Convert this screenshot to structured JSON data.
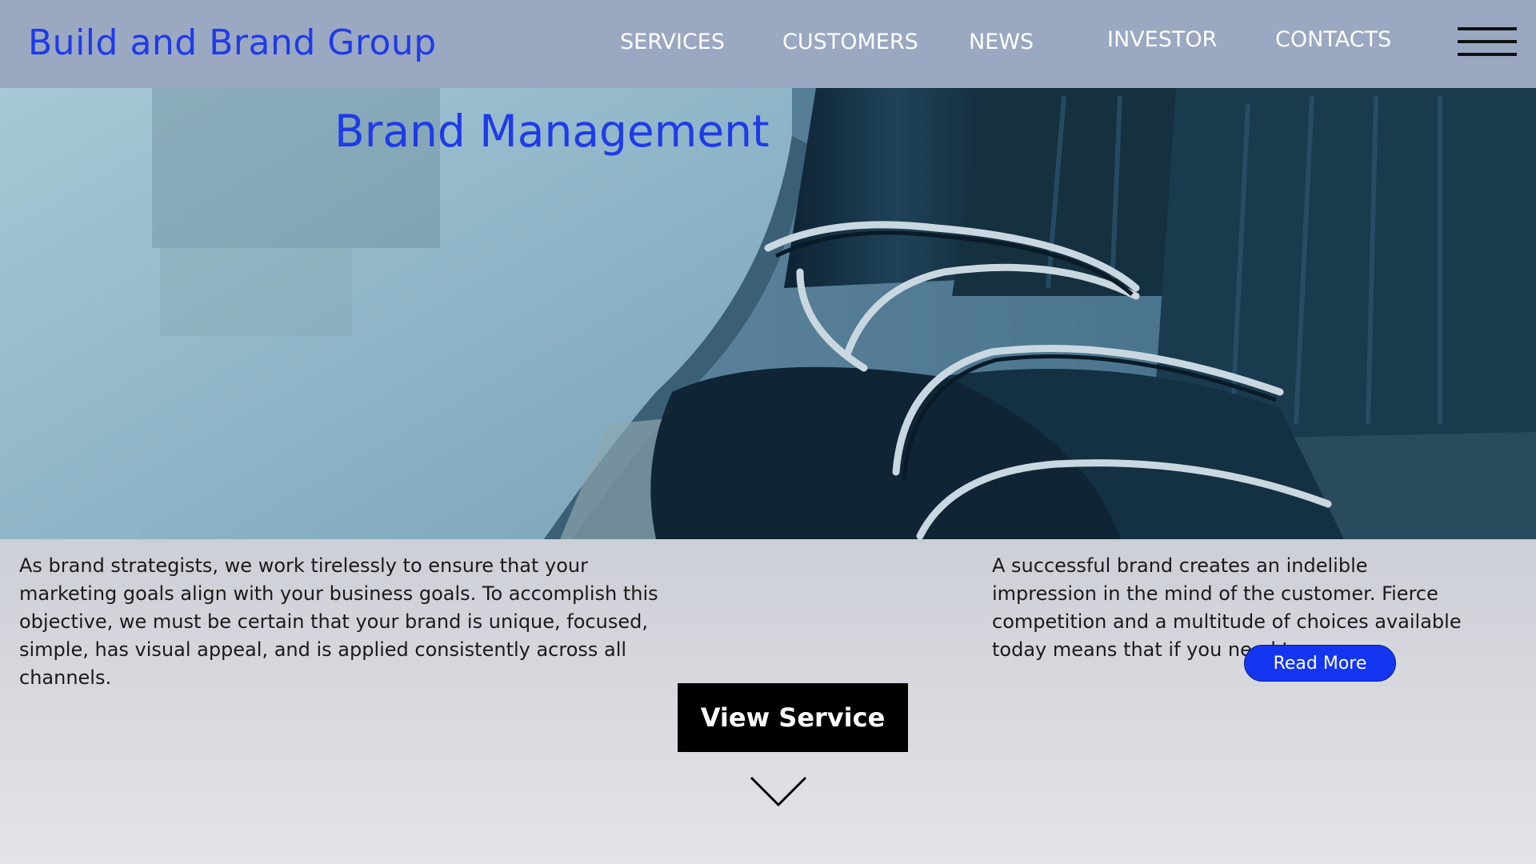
{
  "header": {
    "logo": "Build and Brand Group",
    "nav": [
      {
        "label": "SERVICES"
      },
      {
        "label": "CUSTOMERS"
      },
      {
        "label": "NEWS"
      },
      {
        "label": "INVESTOR"
      },
      {
        "label": "CONTACTS"
      }
    ],
    "menu_icon": "hamburger-menu-icon"
  },
  "hero": {
    "title": "Brand Management",
    "image": "conference-room-chairs-image"
  },
  "content": {
    "left_text": "As brand strategists, we work tirelessly to ensure that your marketing goals align with your business goals. To accomplish this objective, we must be certain that your brand is unique, focused, simple, has visual appeal, and is applied consistently across all channels.",
    "right_text": "A successful brand creates an indelible impression in the mind of the customer. Fierce competition and a multitude of choices available today means that if you need to....",
    "read_more_label": "Read More",
    "view_service_label": "View Service",
    "scroll_icon": "chevron-down-icon"
  },
  "colors": {
    "header_bg": "#9aa8c2",
    "brand_blue": "#1f3be8",
    "button_blue": "#1436f0",
    "button_black": "#000000"
  }
}
